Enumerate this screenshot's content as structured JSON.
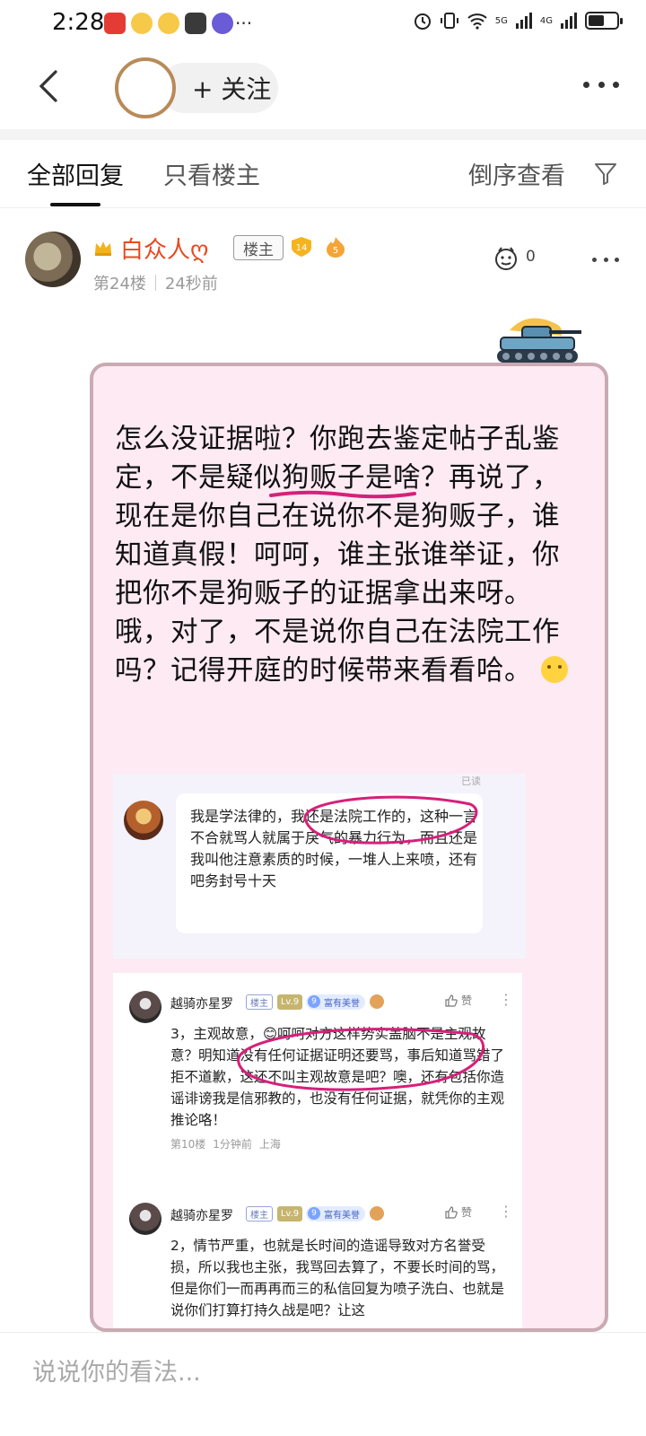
{
  "status_bar": {
    "time": "2:28",
    "net1": "5G",
    "net2": "4G",
    "battery_level": 0.55
  },
  "header": {
    "follow_label": "+ 关注"
  },
  "tabs": {
    "all": "全部回复",
    "op_only": "只看楼主",
    "reverse": "倒序查看"
  },
  "post": {
    "username": "白众人ღ",
    "op_badge": "楼主",
    "level": "14",
    "fire_level": "5",
    "floor": "第24楼",
    "time": "24秒前",
    "like_count": "0",
    "text_part1": "怎么没证据啦？你跑去鉴定帖子乱鉴定，不是",
    "text_highlight": "疑似狗贩子",
    "text_part2": "是啥？再说了，现在是你自己在说你不是狗贩子，谁知道真假！呵呵，谁主张谁举证，你把你不是狗贩子的证据拿出来呀。哦，对了，不是说你自己在法院工作吗？记得开庭的时候带来看看哈。"
  },
  "screenshot1": {
    "seen": "已读",
    "message": "我是学法律的，我还是法院工作的，这种一言不合就骂人就属于戾气的暴力行为，而且还是我叫他注意素质的时候，一堆人上来喷，还有吧务封号十天"
  },
  "screenshot2": {
    "comments": [
      {
        "name": "越骑亦星罗",
        "op": "楼主",
        "lv": "Lv.9",
        "rich": "富有美誉",
        "like": "赞",
        "text": "3，主观故意，😊呵呵对方这样势实盖脑不是主观故意？明知道没有任何证据证明还要骂，事后知道骂错了拒不道歉，这还不叫主观故意是吧？噢，还有包括你造谣诽谤我是信邪教的，也没有任何证据，就凭你的主观推论咯！",
        "floor": "第10楼",
        "time": "1分钟前",
        "loc": "上海"
      },
      {
        "name": "越骑亦星罗",
        "op": "楼主",
        "lv": "Lv.9",
        "rich": "富有美誉",
        "like": "赞",
        "text": "2，情节严重，也就是长时间的造谣导致对方名誉受损，所以我也主张，我骂回去算了，不要长时间的骂，但是你们一而再再而三的私信回复为喷子洗白、也就是说你们打算打持久战是吧？让这"
      }
    ]
  },
  "input": {
    "placeholder": "说说你的看法..."
  },
  "colors": {
    "username": "#e8481f",
    "bubble_bg": "#fdeaf2",
    "highlight_mark": "#d6207a"
  }
}
